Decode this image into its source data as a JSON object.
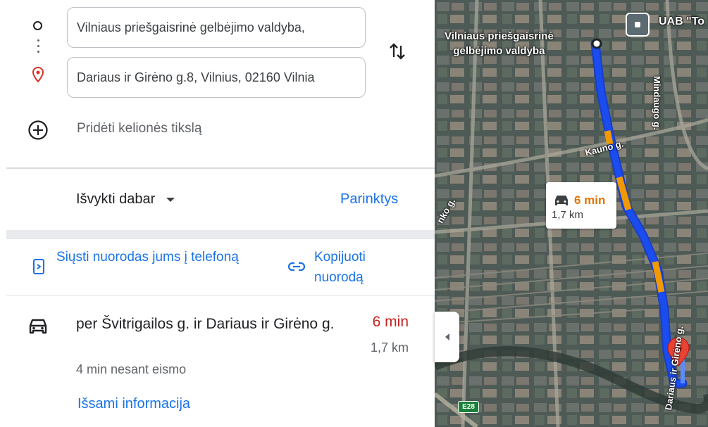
{
  "directions": {
    "origin_value": "Vilniaus priešgaisrinė gelbėjimo valdyba,",
    "destination_value": "Dariaus ir Girėno g.8, Vilnius, 02160 Vilnia",
    "add_destination_label": "Pridėti kelionės tikslą"
  },
  "departure": {
    "label": "Išvykti dabar",
    "options_label": "Parinktys"
  },
  "share": {
    "send_label": "Siųsti nuorodas jums į telefoną",
    "copy_label": "Kopijuoti nuorodą"
  },
  "route": {
    "name": "per Švitrigailos g. ir Dariaus ir Girėno g.",
    "time": "6 min",
    "distance": "1,7 km",
    "no_traffic_note": "4 min nesant eismo",
    "details_label": "Išsami informacija",
    "time_color": "#c5221f"
  },
  "map": {
    "origin_label_line1": "Vilniaus priešgaisrinė",
    "origin_label_line2": "gelbėjimo valdyba",
    "business_label": "UAB \"To",
    "street_labels": {
      "kauno": "Kauno g.",
      "mindaugo": "Mindaugo g.",
      "girenas": "Dariaus ir Girėno g.",
      "left_street": "nko g."
    },
    "highway_shield": "E28",
    "callout_time": "6 min",
    "callout_distance": "1,7 km",
    "route_color": "#1a4cf0",
    "traffic_color": "#f29900"
  },
  "icons": {
    "origin": "origin-circle-icon",
    "destination": "red-pin-icon",
    "swap": "swap-arrows-icon",
    "add": "plus-circle-icon",
    "send": "send-to-phone-icon",
    "copy": "link-icon",
    "car": "car-icon"
  }
}
